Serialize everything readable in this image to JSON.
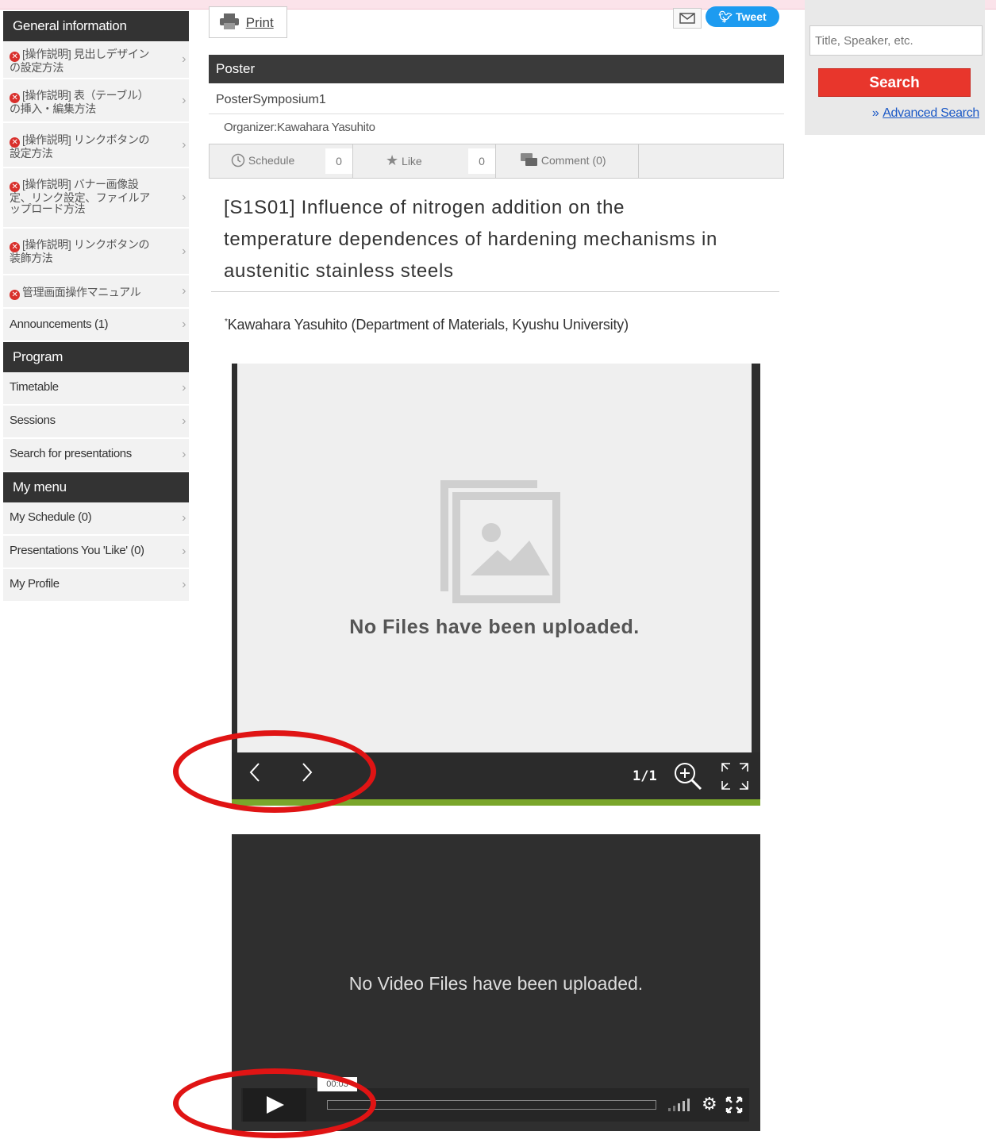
{
  "sidebar": {
    "general_header": "General information",
    "general_items": [
      {
        "label": "[操作説明] 見出しデザインの設定方法",
        "l1": "[操作説明] 見出しデザイン",
        "l2": "の設定方法"
      },
      {
        "label": "[操作説明] 表（テーブル）の挿入・編集方法",
        "l1": "[操作説明] 表（テーブル）",
        "l2": "の挿入・編集方法"
      },
      {
        "label": "[操作説明] リンクボタンの設定方法",
        "l1": "[操作説明] リンクボタンの",
        "l2": "設定方法"
      },
      {
        "label": "[操作説明] バナー画像設定、リンク設定、ファイルアップロード方法",
        "l1": "[操作説明] バナー画像設",
        "l2": "定、リンク設定、ファイルア",
        "l3": "ップロード方法"
      },
      {
        "label": "[操作説明] リンクボタンの装飾方法",
        "l1": "[操作説明] リンクボタンの",
        "l2": "装飾方法"
      },
      {
        "label": "管理画面操作マニュアル",
        "l1": "管理画面操作マニュアル"
      }
    ],
    "announcements": "Announcements (1)",
    "program_header": "Program",
    "program_items": [
      "Timetable",
      "Sessions",
      "Search for presentations"
    ],
    "mymenu_header": "My menu",
    "mymenu_items": [
      "My Schedule (0)",
      "Presentations You 'Like' (0)",
      "My Profile"
    ]
  },
  "search": {
    "placeholder": "Title, Speaker, etc.",
    "button": "Search",
    "advanced_prefix": "»",
    "advanced": "Advanced Search"
  },
  "toolbar": {
    "print": "Print",
    "tweet": "Tweet"
  },
  "poster": {
    "header": "Poster",
    "symposium": "PosterSymposium1",
    "organizer": "Organizer:Kawahara Yasuhito",
    "schedule_label": "Schedule",
    "schedule_count": "0",
    "like_label": "Like",
    "like_count": "0",
    "comment_label": "Comment (0)",
    "title_lines": [
      "[S1S01] Influence of nitrogen addition on the",
      "temperature dependences of hardening mechanisms in",
      "austenitic stainless steels"
    ],
    "author_mark": "*",
    "authors": "Kawahara Yasuhito (Department of Materials, Kyushu University)"
  },
  "viewer": {
    "message": "No Files have been uploaded.",
    "page_indicator": "1/1"
  },
  "video": {
    "message": "No Video Files have been uploaded.",
    "time": "00:03",
    "progress_fraction": 0.0
  },
  "colors": {
    "accent_red": "#e8362c",
    "annotation_red": "#e01414",
    "progress_green": "#7aa62b",
    "tweet_blue": "#1d9bf0"
  }
}
